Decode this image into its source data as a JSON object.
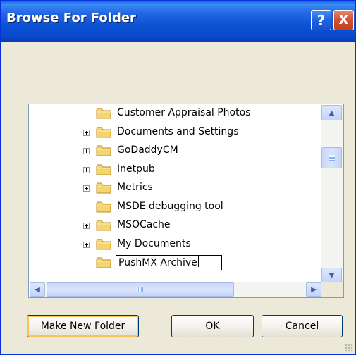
{
  "window": {
    "title": "Browse For Folder",
    "help_label": "?",
    "close_label": "X"
  },
  "tree": {
    "items": [
      {
        "label": "Customer Appraisal Photos",
        "expandable": false
      },
      {
        "label": "Documents and Settings",
        "expandable": true
      },
      {
        "label": "GoDaddyCM",
        "expandable": true
      },
      {
        "label": "Inetpub",
        "expandable": true
      },
      {
        "label": "Metrics",
        "expandable": true
      },
      {
        "label": "MSDE debugging tool",
        "expandable": false
      },
      {
        "label": "MSOCache",
        "expandable": true
      },
      {
        "label": "My Documents",
        "expandable": true
      },
      {
        "label": "PushMX Archive",
        "expandable": false,
        "editing": true
      }
    ]
  },
  "buttons": {
    "make_new_folder": "Make New Folder",
    "ok": "OK",
    "cancel": "Cancel"
  },
  "colors": {
    "titlebar": "#0A4ACB",
    "dialog_bg": "#ECE9D8",
    "folder": "#F6D56E"
  }
}
